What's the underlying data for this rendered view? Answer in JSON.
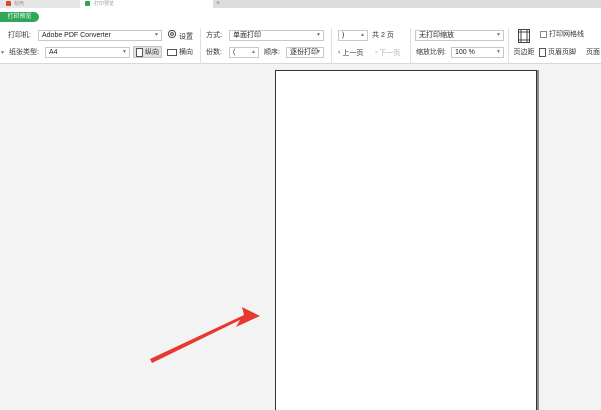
{
  "tabs": [
    {
      "label": "稻壳"
    },
    {
      "label": "打印预览"
    },
    {
      "label": "+"
    }
  ],
  "toolbar": {
    "preview_badge": "打印预览",
    "printer_label": "打印机:",
    "printer_value": "Adobe PDF Converter",
    "paper_label": "纸张类型:",
    "paper_value": "A4",
    "settings_label": "设置",
    "portrait_label": "纵向",
    "landscape_label": "横向",
    "mode_label": "方式:",
    "mode_value": "单面打印",
    "copies_label": "份数:",
    "copies_value": "(",
    "order_label": "顺序:",
    "order_value": "逐份打印",
    "page_input_value": ")",
    "total_pages": "共 2 页",
    "prev_page": "上一页",
    "next_page": "下一页",
    "scale_mode_value": "无打印缩放",
    "zoom_label": "缩放比例:",
    "zoom_value": "100 %",
    "margins_label": "页边距",
    "print_gridlines_label": "打印网格线",
    "header_footer_label": "页眉页脚",
    "overflow_label": "页面"
  },
  "colors": {
    "accent_green": "#2ea757",
    "arrow_red": "#e8392f",
    "workspace_bg": "#f3f3f3"
  }
}
